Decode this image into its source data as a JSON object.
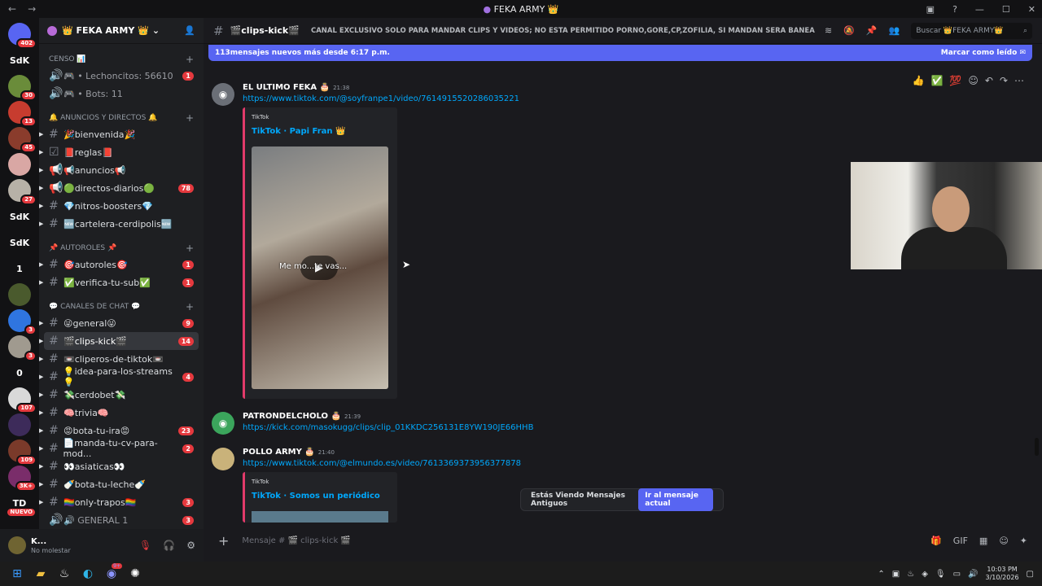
{
  "window": {
    "title": "FEKA ARMY 👑",
    "back": "←",
    "forward": "→"
  },
  "guilds": [
    {
      "label": "",
      "badge": "402",
      "color": "#5865f2",
      "icon": "discord-home-icon"
    },
    {
      "label": "SdK",
      "badge": "",
      "color": "transparent"
    },
    {
      "label": "",
      "badge": "30",
      "color": "#6a8c3a"
    },
    {
      "label": "",
      "badge": "13",
      "color": "#c73c2f"
    },
    {
      "label": "",
      "badge": "45",
      "color": "#8a3c2c"
    },
    {
      "label": "",
      "badge": "",
      "color": "#d9a7a4"
    },
    {
      "label": "",
      "badge": "27",
      "color": "#b7b1a7"
    },
    {
      "label": "SdK",
      "badge": "",
      "color": "transparent"
    },
    {
      "label": "SdK",
      "badge": "",
      "color": "transparent"
    },
    {
      "label": "1",
      "badge": "",
      "color": "transparent"
    },
    {
      "label": "",
      "badge": "",
      "color": "#4a5a2d"
    },
    {
      "label": "",
      "badge": "3",
      "color": "#2f75e0"
    },
    {
      "label": "",
      "badge": "3",
      "color": "#a09a8f"
    },
    {
      "label": "0",
      "badge": "",
      "color": "transparent"
    },
    {
      "label": "",
      "badge": "107",
      "color": "#d9d9d9"
    },
    {
      "label": "",
      "badge": "",
      "color": "#3d2b5a"
    },
    {
      "label": "",
      "badge": "109",
      "color": "#7a3a2a"
    },
    {
      "label": "",
      "badge": "3K+",
      "color": "#7a2d6a"
    },
    {
      "label": "TD",
      "badge": "NUEVO",
      "color": "transparent"
    }
  ],
  "server": {
    "name": "👑 FEKA ARMY 👑"
  },
  "sidebar": [
    {
      "type": "cat",
      "label": "CENSO 📊"
    },
    {
      "type": "voice",
      "label": "🎮 • Lechoncitos: 56610",
      "badge": "1"
    },
    {
      "type": "voice",
      "label": "🎮 • Bots: 11",
      "badge": ""
    },
    {
      "type": "cat",
      "label": "🔔 ANUNCIOS Y DIRECTOS 🔔"
    },
    {
      "type": "text",
      "label": "🎉bienvenida🎉",
      "badge": ""
    },
    {
      "type": "rules",
      "label": "📕reglas📕",
      "badge": ""
    },
    {
      "type": "announce",
      "label": "📢anuncios📢",
      "badge": ""
    },
    {
      "type": "announce",
      "label": "🟢directos-diarios🟢",
      "badge": "78"
    },
    {
      "type": "text",
      "label": "💎nitros-boosters💎",
      "badge": ""
    },
    {
      "type": "text",
      "label": "🆕cartelera-cerdipolis🆕",
      "badge": ""
    },
    {
      "type": "cat",
      "label": "📌 AUTOROLES 📌"
    },
    {
      "type": "text",
      "label": "🎯autoroles🎯",
      "badge": "1"
    },
    {
      "type": "text",
      "label": "✅verifica-tu-sub✅",
      "badge": "1"
    },
    {
      "type": "cat",
      "label": "💬 CANALES DE CHAT 💬"
    },
    {
      "type": "text",
      "label": "😜general😜",
      "badge": "9"
    },
    {
      "type": "text",
      "label": "🎬clips-kick🎬",
      "badge": "14",
      "active": true
    },
    {
      "type": "text",
      "label": "📼cliperos-de-tiktok📼",
      "badge": ""
    },
    {
      "type": "text",
      "label": "💡idea-para-los-streams💡",
      "badge": "4"
    },
    {
      "type": "text",
      "label": "💸cerdobet💸",
      "badge": ""
    },
    {
      "type": "text",
      "label": "🧠trivia🧠",
      "badge": ""
    },
    {
      "type": "text",
      "label": "😡bota-tu-ira😡",
      "badge": "23"
    },
    {
      "type": "text",
      "label": "📄manda-tu-cv-para-mod...",
      "badge": "2"
    },
    {
      "type": "text",
      "label": "👀asiaticas👀",
      "badge": ""
    },
    {
      "type": "text",
      "label": "🍼bota-tu-leche🍼",
      "badge": ""
    },
    {
      "type": "text",
      "label": "🏳️‍🌈only-trapos🏳️‍🌈",
      "badge": "3"
    },
    {
      "type": "voice",
      "label": "🔊 GENERAL 1",
      "badge": "3"
    }
  ],
  "user": {
    "name": "K...",
    "status": "No molestar"
  },
  "channel": {
    "name": "🎬clips-kick🎬",
    "topic": "CANAL EXCLUSIVO SOLO PARA MANDAR CLIPS Y VIDEOS; NO ESTA PERMITIDO PORNO,GORE,CP,ZOFILIA, SI MANDAN SERA BANEADO PERMA...",
    "search_placeholder": "Buscar 👑FEKA ARMY👑"
  },
  "new_messages": {
    "text": "113mensajes nuevos más desde 6:17 p.m.",
    "action": "Marcar como leído"
  },
  "messages": [
    {
      "author": "EL ULTIMO FEKA 🎂",
      "time": "21:38",
      "link": "https://www.tiktok.com/@soyfranpe1/video/7614915520286035221",
      "embed_provider": "TikTok",
      "embed_title": "TikTok · Papi Fran 👑",
      "video_caption": "Me mo...te vas..."
    },
    {
      "author": "PATRONDELCHOLO 🎂",
      "time": "21:39",
      "link": "https://kick.com/masokugg/clips/clip_01KKDC256131E8YW190JE66HHB"
    },
    {
      "author": "POLLO ARMY 🎂",
      "time": "21:40",
      "link": "https://www.tiktok.com/@elmundo.es/video/7613369373956377878",
      "embed_provider": "TikTok",
      "embed_title": "TikTok · Somos un periódico"
    }
  ],
  "old_messages": {
    "text": "Estás Viendo Mensajes Antiguos",
    "action": "Ir al mensaje actual"
  },
  "composer": {
    "placeholder": "Mensaje # 🎬 clips-kick 🎬"
  },
  "taskbar": {
    "time": "10:03 PM",
    "date": "3/10/2026",
    "discord_badge": "9+"
  }
}
